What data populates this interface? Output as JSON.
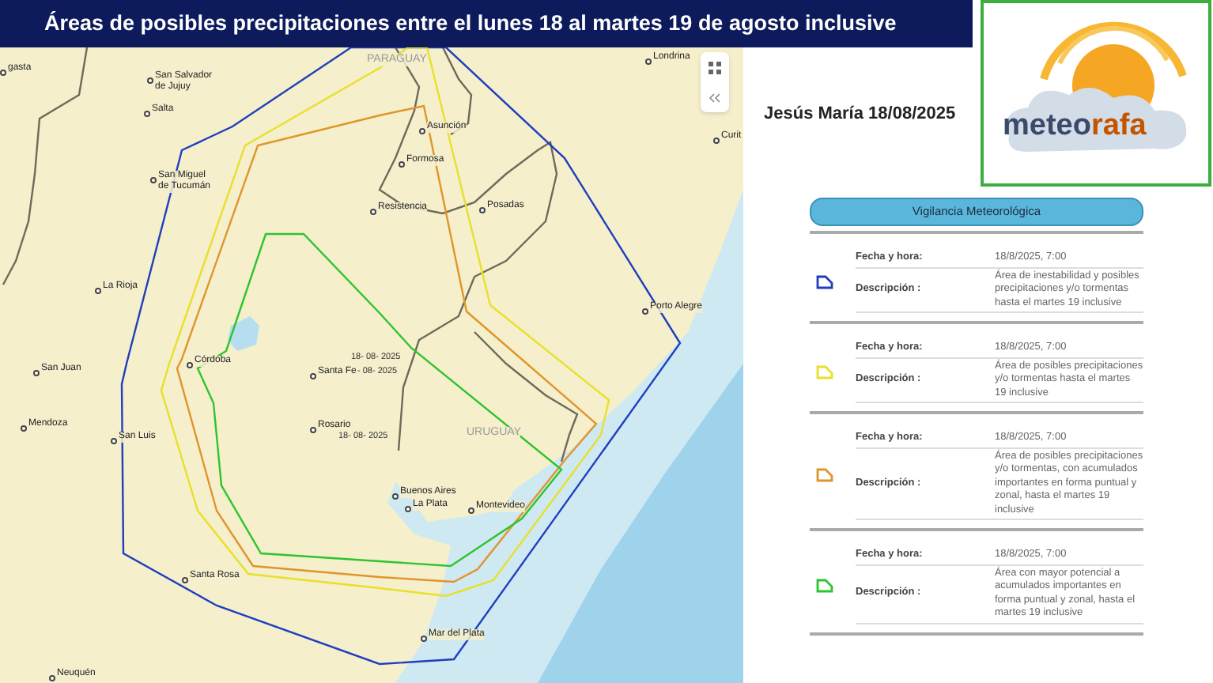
{
  "title": "Áreas de posibles precipitaciones entre el lunes 18 al martes 19 de agosto inclusive",
  "map": {
    "labels": [
      {
        "text": "gasta",
        "kind": "city"
      },
      {
        "text": "PARAGUAY",
        "kind": "country"
      },
      {
        "text": "Londrina",
        "kind": "city"
      },
      {
        "text": "San Salvador de Jujuy",
        "kind": "city"
      },
      {
        "text": "Asunción",
        "kind": "city"
      },
      {
        "text": "Salta",
        "kind": "city"
      },
      {
        "text": "Curit",
        "kind": "city"
      },
      {
        "text": "Formosa",
        "kind": "city"
      },
      {
        "text": "San Miguel de Tucumán",
        "kind": "city"
      },
      {
        "text": "Resistencia",
        "kind": "city"
      },
      {
        "text": "Posadas",
        "kind": "city"
      },
      {
        "text": "La Rioja",
        "kind": "city"
      },
      {
        "text": "Porto Alegre",
        "kind": "city"
      },
      {
        "text": "San Juan",
        "kind": "city"
      },
      {
        "text": "18- 08- 2025",
        "kind": "date"
      },
      {
        "text": "Córdoba",
        "kind": "city"
      },
      {
        "text": "Santa Fe",
        "kind": "city"
      },
      {
        "text": "- 08- 2025",
        "kind": "date"
      },
      {
        "text": "Rosario",
        "kind": "city"
      },
      {
        "text": "18- 08- 2025",
        "kind": "date"
      },
      {
        "text": "URUGUAY",
        "kind": "country"
      },
      {
        "text": "Mendoza",
        "kind": "city"
      },
      {
        "text": "San Luis",
        "kind": "city"
      },
      {
        "text": "Buenos Aires",
        "kind": "city"
      },
      {
        "text": "La Plata",
        "kind": "city"
      },
      {
        "text": "Montevideo",
        "kind": "city"
      },
      {
        "text": "Santa Rosa",
        "kind": "city"
      },
      {
        "text": "Mar del Plata",
        "kind": "city"
      },
      {
        "text": "Neuquén",
        "kind": "city"
      }
    ]
  },
  "author_date": "Jesús María 18/08/2025",
  "logo": {
    "word": "meteo",
    "accent": "rafa"
  },
  "panel": {
    "title": "Vigilancia Meteorológica",
    "alerts": [
      {
        "color": "#1f3fbf",
        "date_label": "Fecha y hora:",
        "date": "18/8/2025, 7:00",
        "description_label": "Descripción :",
        "description": "Área de inestabilidad y posibles precipitaciones y/o tormentas hasta el martes 19 inclusive"
      },
      {
        "color": "#e8e02a",
        "date_label": "Fecha y hora:",
        "date": "18/8/2025, 7:00",
        "description_label": "Descripción :",
        "description": "Área de posibles precipitaciones y/o tormentas hasta el martes 19 inclusive"
      },
      {
        "color": "#e0952a",
        "date_label": "Fecha y hora:",
        "date": "18/8/2025, 7:00",
        "description_label": "Descripción :",
        "description": "Área de posibles precipitaciones y/o tormentas, con acumulados importantes en forma puntual y zonal, hasta el martes 19 inclusive"
      },
      {
        "color": "#2ec42e",
        "date_label": "Fecha y hora:",
        "date": "18/8/2025, 7:00",
        "description_label": "Descripción :",
        "description": "Área con mayor potencial a acumulados importantes en forma puntual y zonal, hasta el martes 19 inclusive"
      }
    ]
  }
}
